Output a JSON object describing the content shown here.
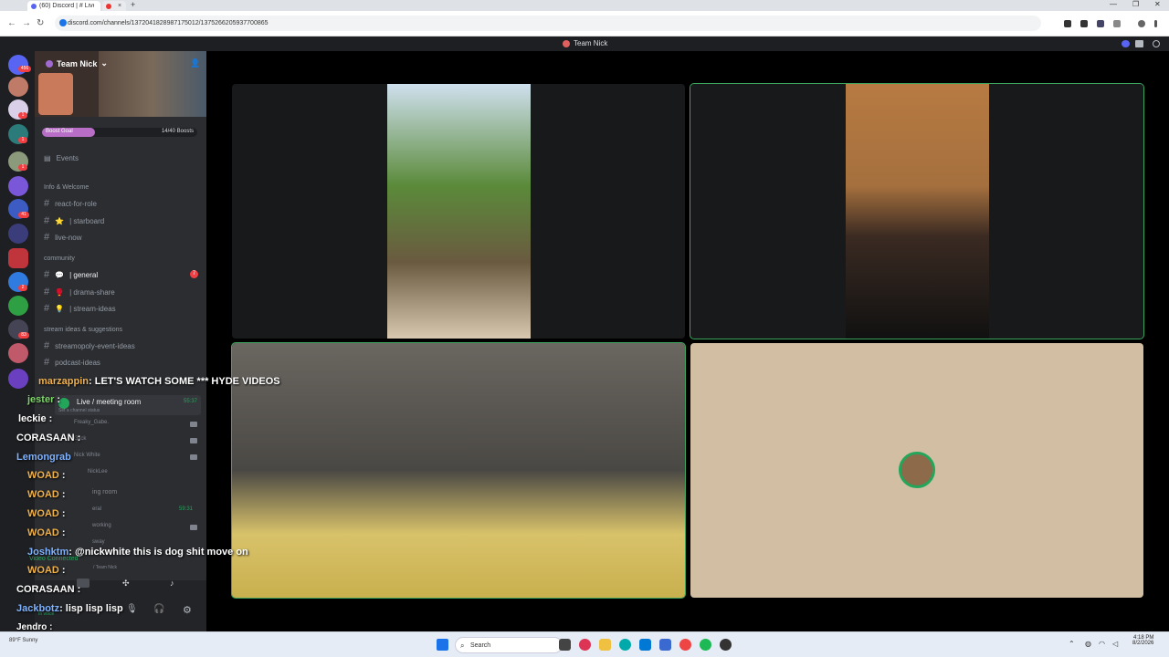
{
  "browser": {
    "tab1": "(60) Discord | # Live / ...",
    "tab2_close": "×",
    "new_tab": "+",
    "url": "discord.com/channels/1372041828987175012/1375266205937700865",
    "nav": {
      "back": "←",
      "forward": "→",
      "reload": "↻"
    },
    "window": {
      "min": "—",
      "max": "❐",
      "close": "✕"
    }
  },
  "discord": {
    "top_title": "Team Nick",
    "server_name": "Team Nick",
    "boost_label": "Boost Goal",
    "boost_count": "14/40 Boosts",
    "events": "Events",
    "rail_badges": [
      "456",
      "1",
      "1",
      "1",
      "41",
      "2",
      "83"
    ],
    "categories": [
      "Info & Welcome",
      "community",
      "stream ideas & suggestions"
    ],
    "channels": [
      {
        "name": "react-for-role",
        "emoji": ""
      },
      {
        "name": "starboard",
        "emoji": "⭐"
      },
      {
        "name": "live-now",
        "emoji": ""
      },
      {
        "name": "general",
        "emoji": "💬"
      },
      {
        "name": "drama-share",
        "emoji": "🥊"
      },
      {
        "name": "stream-ideas",
        "emoji": "💡"
      },
      {
        "name": "streamopoly-event-ideas",
        "emoji": ""
      },
      {
        "name": "podcast-ideas",
        "emoji": ""
      }
    ],
    "general_unread": "7",
    "voice_channel": "Live / meeting room",
    "voice_timer": "55:37",
    "voice_status": "Set a channel status",
    "voice_users": [
      "Freaky_Gabe.",
      "Glick",
      "Nick White",
      "NickLee"
    ],
    "other_room": "ing room",
    "other_timer": "59:31",
    "other_users": [
      "eral",
      "working",
      "sway"
    ],
    "connection": "Video Connected",
    "connection_sub": "/ Team Nick",
    "self_status": "In voice"
  },
  "chat": [
    {
      "name": "marzappin",
      "text": ": LET'S WATCH SOME *** HYDE VIDEOS",
      "color": "#f0b04a"
    },
    {
      "name": "jester",
      "text": ":",
      "color": "#7fd46b"
    },
    {
      "name": "leckie",
      "text": ":",
      "color": "#ffffff"
    },
    {
      "name": "CORASAAN",
      "text": ":",
      "color": "#ffffff"
    },
    {
      "name": "Lemongrab",
      "text": "",
      "color": "#7fb2ff"
    },
    {
      "name": "WOAD",
      "text": ":",
      "color": "#f0b04a"
    },
    {
      "name": "WOAD",
      "text": ":",
      "color": "#f0b04a"
    },
    {
      "name": "WOAD",
      "text": ":",
      "color": "#f0b04a"
    },
    {
      "name": "WOAD",
      "text": ":",
      "color": "#f0b04a"
    },
    {
      "name": "Joshktm",
      "text": ": @nickwhite this is dog shit move on",
      "color": "#7fb2ff"
    },
    {
      "name": "WOAD",
      "text": ":",
      "color": "#f0b04a"
    },
    {
      "name": "CORASAAN",
      "text": ":",
      "color": "#ffffff"
    },
    {
      "name": "Jackbotz",
      "text": ": lisp lisp lisp",
      "color": "#7fb2ff"
    },
    {
      "name": "Jendro",
      "text": ":",
      "color": "#ffffff"
    }
  ],
  "taskbar": {
    "search": "Search",
    "weather": "89°F Sunny",
    "time": "4:18 PM",
    "date": "8/2/2026"
  },
  "colors": {
    "speaking": "#3ba55d",
    "discord_dark": "#1e1f22",
    "channel_bg": "#2b2d31",
    "idle_tile": "#d2bea3"
  }
}
